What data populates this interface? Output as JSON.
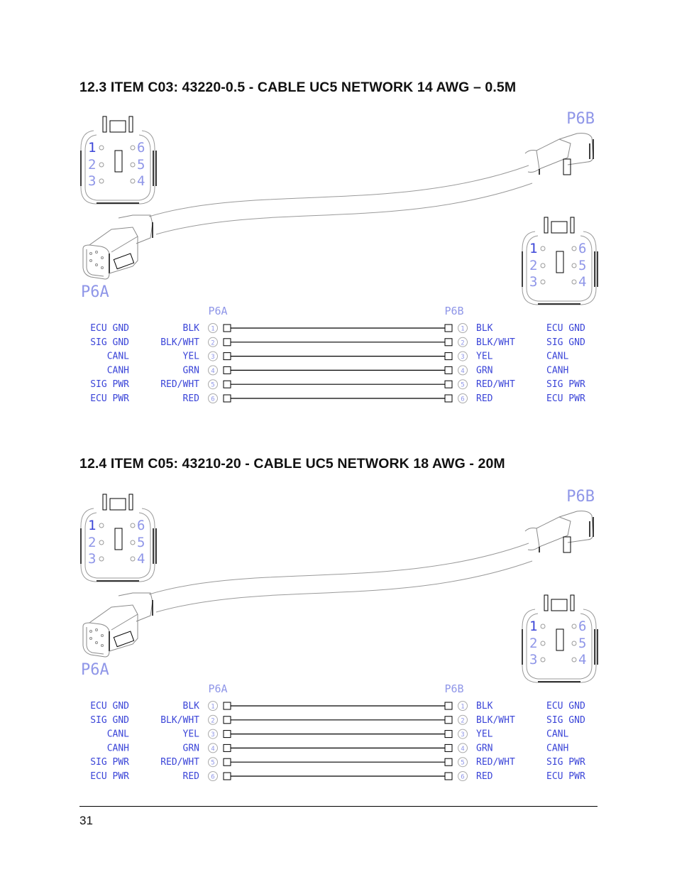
{
  "sections": [
    {
      "title": "12.3  ITEM C03: 43220-0.5 - CABLE UC5 NETWORK 14 AWG – 0.5M",
      "connector_left_label": "P6A",
      "connector_right_label": "P6B",
      "face_pins_left": [
        "1",
        "2",
        "3"
      ],
      "face_pins_right": [
        "6",
        "5",
        "4"
      ],
      "table_header_left": "P6A",
      "table_header_right": "P6B",
      "wires": [
        {
          "pin": "1",
          "signal": "ECU GND",
          "color": "BLK"
        },
        {
          "pin": "2",
          "signal": "SIG GND",
          "color": "BLK/WHT"
        },
        {
          "pin": "3",
          "signal": "CANL",
          "color": "YEL"
        },
        {
          "pin": "4",
          "signal": "CANH",
          "color": "GRN"
        },
        {
          "pin": "5",
          "signal": "SIG PWR",
          "color": "RED/WHT"
        },
        {
          "pin": "6",
          "signal": "ECU PWR",
          "color": "RED"
        }
      ]
    },
    {
      "title": "12.4  ITEM C05: 43210-20 - CABLE UC5 NETWORK 18 AWG - 20M",
      "connector_left_label": "P6A",
      "connector_right_label": "P6B",
      "face_pins_left": [
        "1",
        "2",
        "3"
      ],
      "face_pins_right": [
        "6",
        "5",
        "4"
      ],
      "table_header_left": "P6A",
      "table_header_right": "P6B",
      "wires": [
        {
          "pin": "1",
          "signal": "ECU GND",
          "color": "BLK"
        },
        {
          "pin": "2",
          "signal": "SIG GND",
          "color": "BLK/WHT"
        },
        {
          "pin": "3",
          "signal": "CANL",
          "color": "YEL"
        },
        {
          "pin": "4",
          "signal": "CANH",
          "color": "GRN"
        },
        {
          "pin": "5",
          "signal": "SIG PWR",
          "color": "RED/WHT"
        },
        {
          "pin": "6",
          "signal": "ECU PWR",
          "color": "RED"
        }
      ]
    }
  ],
  "footer": {
    "page_number": "31"
  },
  "colors": {
    "label_blue": "#3b45d8",
    "label_light_blue": "#8f96e8",
    "line": "#000000",
    "outline_gray": "#9a9a9a"
  }
}
